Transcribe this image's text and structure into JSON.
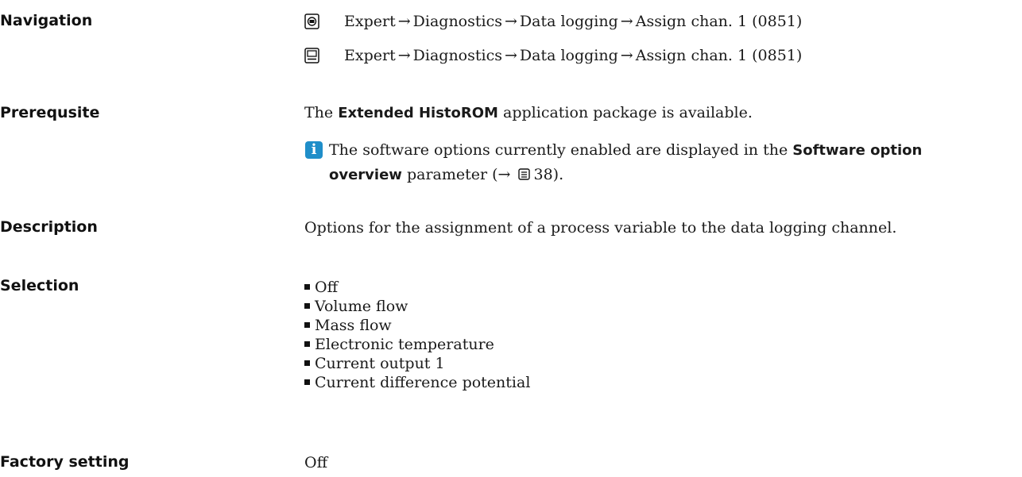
{
  "navigation": {
    "label": "Navigation",
    "paths": [
      {
        "icon": "local-display-icon",
        "crumbs": [
          "Expert",
          "Diagnostics",
          "Data logging",
          "Assign chan. 1 (0851)"
        ]
      },
      {
        "icon": "operating-tool-icon",
        "crumbs": [
          "Expert",
          "Diagnostics",
          "Data logging",
          "Assign chan. 1 (0851)"
        ]
      }
    ],
    "separator": "→"
  },
  "prerequisite": {
    "label": "Prerequsite",
    "text_pre": "The ",
    "text_bold": "Extended HistoROM",
    "text_post": " application package is available.",
    "note": {
      "icon": "info-icon",
      "icon_glyph": "i",
      "text_pre": "The software options currently enabled are displayed in the ",
      "bold_1": "Software option",
      "bold_2": "overview",
      "text_post": " parameter (→",
      "page_ref": "38",
      "text_end": ")."
    }
  },
  "description": {
    "label": "Description",
    "text": "Options for the assignment of a process variable to the data logging channel."
  },
  "selection": {
    "label": "Selection",
    "items": [
      "Off",
      "Volume flow",
      "Mass flow",
      "Electronic temperature",
      "Current output 1",
      "Current difference potential"
    ]
  },
  "factory_setting": {
    "label": "Factory setting",
    "value": "Off"
  },
  "colors": {
    "info_icon": "#1f8ec9",
    "text": "#1a1a1a"
  }
}
